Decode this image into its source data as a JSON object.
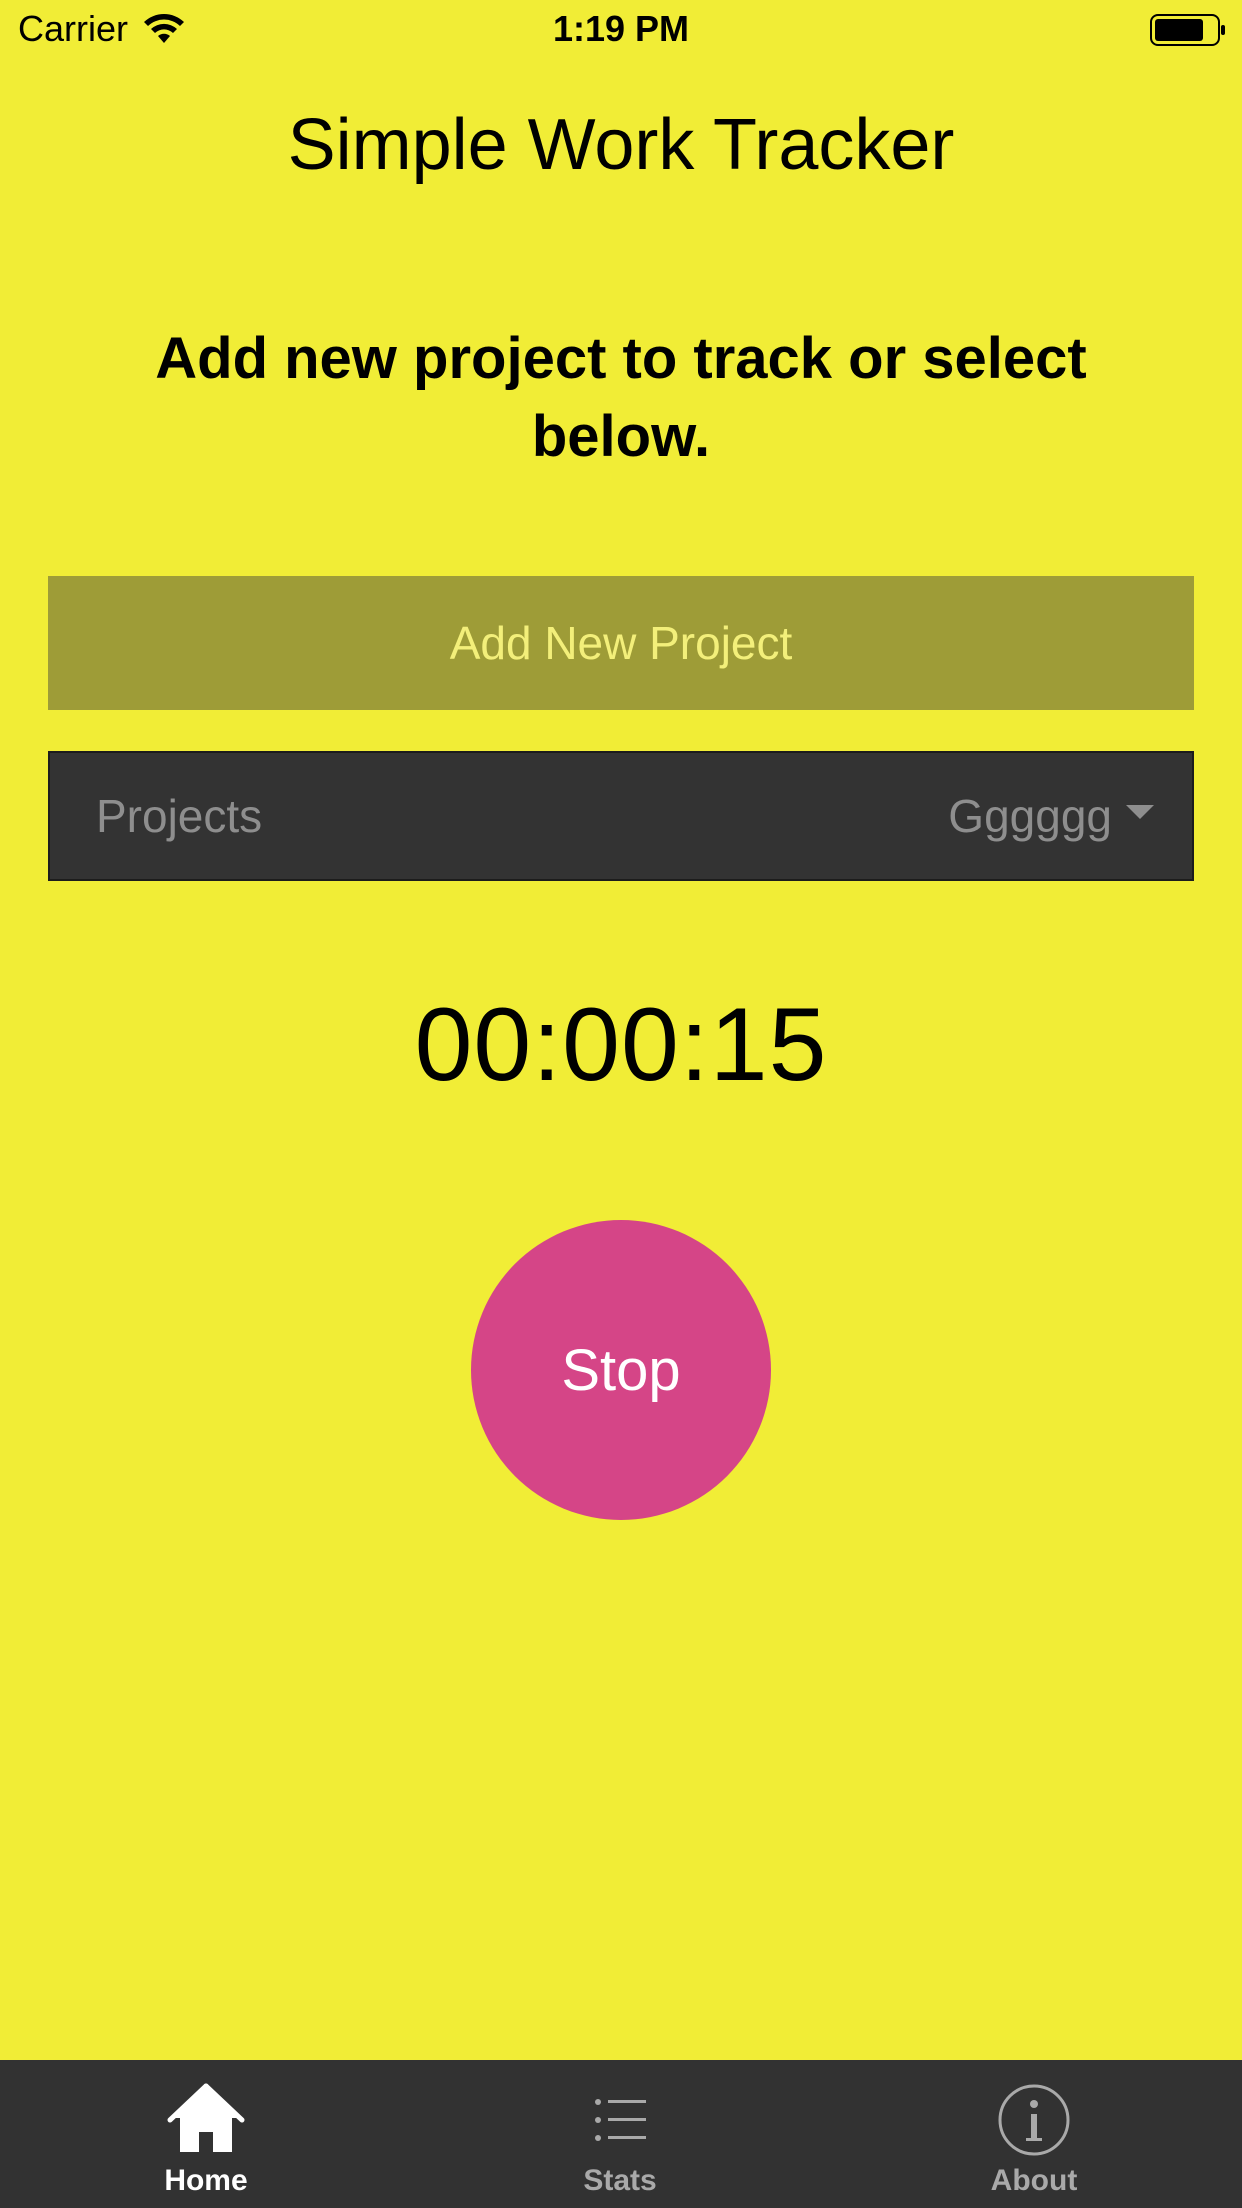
{
  "status_bar": {
    "carrier": "Carrier",
    "time": "1:19 PM"
  },
  "app": {
    "title": "Simple Work Tracker",
    "instruction": "Add new project to track or select below."
  },
  "add_button": {
    "label": "Add New Project"
  },
  "projects": {
    "label": "Projects",
    "selected": "Gggggg"
  },
  "timer": {
    "value": "00:00:15"
  },
  "stop_button": {
    "label": "Stop"
  },
  "tabs": [
    {
      "label": "Home",
      "icon": "home-icon",
      "active": true
    },
    {
      "label": "Stats",
      "icon": "list-icon",
      "active": false
    },
    {
      "label": "About",
      "icon": "info-icon",
      "active": false
    }
  ],
  "colors": {
    "background": "#f1ed36",
    "add_button_bg": "#9e9c37",
    "add_button_text": "#f3ef7a",
    "select_bg": "#333333",
    "stop_button_bg": "#d54587",
    "tab_bar_bg": "#323232"
  }
}
